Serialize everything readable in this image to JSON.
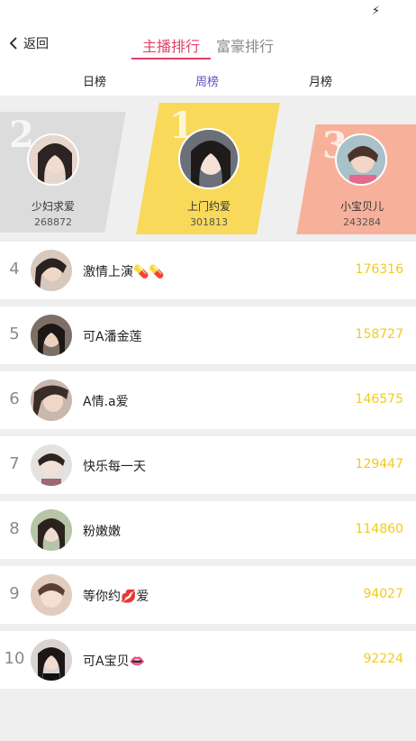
{
  "status": {
    "icon": "charging-icon"
  },
  "nav": {
    "back_label": "返回",
    "tabs": [
      {
        "label": "主播排行",
        "active": true
      },
      {
        "label": "富豪排行",
        "active": false
      }
    ]
  },
  "subtabs": [
    {
      "label": "日榜",
      "active": false
    },
    {
      "label": "周榜",
      "active": true
    },
    {
      "label": "月榜",
      "active": false
    }
  ],
  "podium": [
    {
      "rank": "2",
      "name": "少妇求爱",
      "score": "268872",
      "color": "#dcdcdc"
    },
    {
      "rank": "1",
      "name": "上门约爱",
      "score": "301813",
      "color": "#f8d95a"
    },
    {
      "rank": "3",
      "name": "小宝贝儿",
      "score": "243284",
      "color": "#f7b19a"
    }
  ],
  "list": [
    {
      "rank": "4",
      "name": "激情上演💊💊",
      "score": "176316"
    },
    {
      "rank": "5",
      "name": "可A潘金莲",
      "score": "158727"
    },
    {
      "rank": "6",
      "name": "A情.a爱",
      "score": "146575"
    },
    {
      "rank": "7",
      "name": "快乐每一天",
      "score": "129447"
    },
    {
      "rank": "8",
      "name": "粉嫩嫩",
      "score": "114860"
    },
    {
      "rank": "9",
      "name": "等你约💋爱",
      "score": "94027"
    },
    {
      "rank": "10",
      "name": "可A宝贝👄",
      "score": "92224"
    }
  ],
  "colors": {
    "accent": "#e0406a",
    "subtab_active": "#6a4cc6",
    "score": "#f3cb16"
  }
}
